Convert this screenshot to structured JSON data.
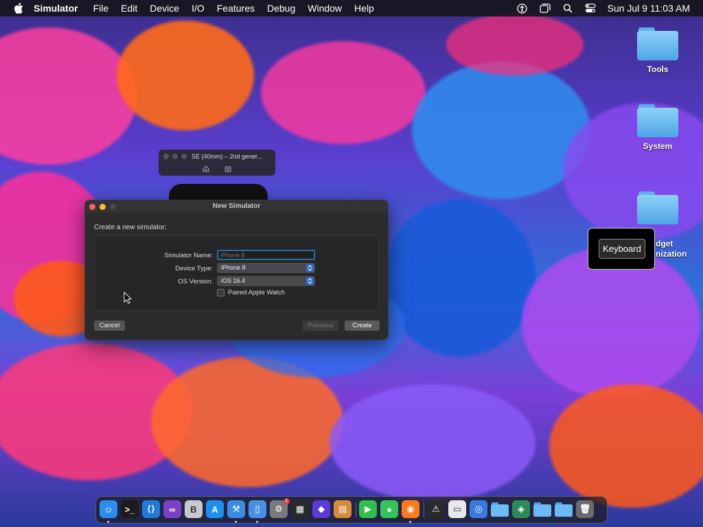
{
  "menubar": {
    "app_name": "Simulator",
    "items": [
      "File",
      "Edit",
      "Device",
      "I/O",
      "Features",
      "Debug",
      "Window",
      "Help"
    ],
    "status_icons": [
      "accessibility-icon",
      "window-icon",
      "search-icon",
      "control-center-icon"
    ],
    "clock": "Sun Jul 9  11:03 AM"
  },
  "desktop": {
    "icons": [
      {
        "label": "Tools"
      },
      {
        "label": "System"
      },
      {
        "label": "dget\nnization"
      }
    ]
  },
  "keyboard_popup": {
    "label": "Keyboard"
  },
  "simulator_window": {
    "title": "SE (40mm) – 2nd gener..."
  },
  "dialog": {
    "title": "New Simulator",
    "subtitle": "Create a new simulator:",
    "simulator_name_label": "Simulator Name:",
    "simulator_name_placeholder": "iPhone 8",
    "device_type_label": "Device Type:",
    "device_type_value": "iPhone 8",
    "os_version_label": "OS Version:",
    "os_version_value": "iOS 16.4",
    "paired_watch_label": "Paired Apple Watch",
    "cancel_label": "Cancel",
    "previous_label": "Previous",
    "create_label": "Create"
  },
  "dock": {
    "items": [
      {
        "name": "finder-icon",
        "glyph": "☺",
        "color": "#2d8cf0",
        "running": true
      },
      {
        "name": "terminal-icon",
        "glyph": ">_",
        "color": "#1c1c1c",
        "running": false
      },
      {
        "name": "vscode-icon",
        "glyph": "⟨⟩",
        "color": "#1f7ad8",
        "running": false
      },
      {
        "name": "visual-studio-icon",
        "glyph": "∞",
        "color": "#7b3fc8",
        "running": false
      },
      {
        "name": "bbedit-icon",
        "glyph": "B",
        "color": "#c8c8d0",
        "running": false
      },
      {
        "name": "app-store-icon",
        "glyph": "A",
        "color": "#1d8ff2",
        "running": false
      },
      {
        "name": "xcode-icon",
        "glyph": "⚒",
        "color": "#3a8de0",
        "running": true
      },
      {
        "name": "simulator-icon",
        "glyph": "▯",
        "color": "#4a90e2",
        "running": true
      },
      {
        "name": "system-settings-icon",
        "glyph": "⚙",
        "color": "#7a7a7a",
        "running": false,
        "badge": "1"
      },
      {
        "name": "activity-monitor-icon",
        "glyph": "▦",
        "color": "#2a2a2a",
        "running": false
      },
      {
        "name": "shortcuts-icon",
        "glyph": "◆",
        "color": "#5a3ad8",
        "running": false
      },
      {
        "name": "launchpad-icon",
        "glyph": "▤",
        "color": "#d88a3a",
        "running": false
      },
      {
        "name": "facetime-icon",
        "glyph": "▶",
        "color": "#2fbf4a",
        "running": false
      },
      {
        "name": "messages-icon",
        "glyph": "●",
        "color": "#35c35a",
        "running": false
      },
      {
        "name": "firefox-icon",
        "glyph": "◉",
        "color": "#ff7a1a",
        "running": true
      },
      {
        "name": "console-icon",
        "glyph": "⚠",
        "color": "#2a2a2a",
        "running": false
      },
      {
        "name": "document-icon",
        "glyph": "▭",
        "color": "#e8e8e8",
        "running": false
      },
      {
        "name": "chrome-icon",
        "glyph": "◎",
        "color": "#3a7ae0",
        "running": false
      },
      {
        "name": "folder-icon",
        "glyph": "",
        "color": "#58aaf0",
        "running": false
      },
      {
        "name": "sourcetree-icon",
        "glyph": "◈",
        "color": "#2e8a5a",
        "running": false
      },
      {
        "name": "folder-icon-2",
        "glyph": "",
        "color": "#58aaf0",
        "running": false
      },
      {
        "name": "folder-icon-3",
        "glyph": "",
        "color": "#58aaf0",
        "running": false
      },
      {
        "name": "trash-icon",
        "glyph": "🗑",
        "color": "#6a6a6a",
        "running": false
      }
    ]
  }
}
